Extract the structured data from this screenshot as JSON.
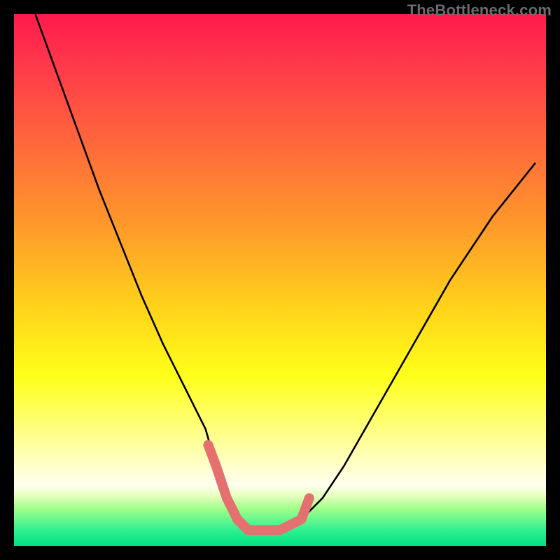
{
  "watermark": "TheBottleneck.com",
  "colors": {
    "frame": "#000000",
    "curve": "#000000",
    "highlight": "#e47070",
    "gradient_stops": [
      {
        "offset": 0.0,
        "color": "#ff1a4d"
      },
      {
        "offset": 0.1,
        "color": "#ff3a4a"
      },
      {
        "offset": 0.25,
        "color": "#ff6a3a"
      },
      {
        "offset": 0.4,
        "color": "#ff9a2a"
      },
      {
        "offset": 0.55,
        "color": "#ffd21a"
      },
      {
        "offset": 0.68,
        "color": "#ffff1a"
      },
      {
        "offset": 0.78,
        "color": "#ffff80"
      },
      {
        "offset": 0.84,
        "color": "#ffffc0"
      },
      {
        "offset": 0.885,
        "color": "#fffff0"
      },
      {
        "offset": 0.905,
        "color": "#e8ffc0"
      },
      {
        "offset": 0.93,
        "color": "#a0ff8a"
      },
      {
        "offset": 0.97,
        "color": "#30f090"
      },
      {
        "offset": 1.0,
        "color": "#00e080"
      }
    ]
  },
  "chart_data": {
    "type": "line",
    "title": "",
    "xlabel": "",
    "ylabel": "",
    "xlim": [
      0,
      100
    ],
    "ylim": [
      0,
      100
    ],
    "x": [
      4,
      8,
      12,
      16,
      20,
      24,
      28,
      32,
      36,
      38,
      40,
      42,
      44,
      46,
      50,
      54,
      58,
      62,
      66,
      70,
      74,
      78,
      82,
      86,
      90,
      94,
      98
    ],
    "values": [
      100,
      89,
      78,
      67,
      57,
      47,
      38,
      30,
      22,
      15,
      9,
      5,
      3,
      3,
      3,
      5,
      9,
      15,
      22,
      29,
      36,
      43,
      50,
      56,
      62,
      67,
      72
    ],
    "highlight": {
      "x_range": [
        38,
        54
      ],
      "y": 3
    },
    "annotations": []
  }
}
